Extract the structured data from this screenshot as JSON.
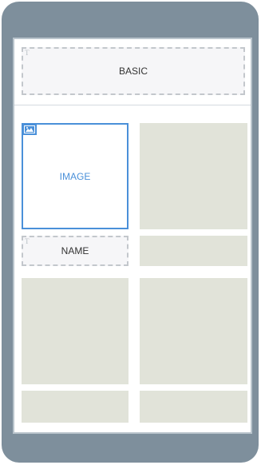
{
  "header": {
    "label": "BASIC"
  },
  "image_block": {
    "label": "IMAGE",
    "icon": "image-icon"
  },
  "name_block": {
    "label": "NAME"
  },
  "colors": {
    "frame": "#7e8f9c",
    "tile": "#e1e3d9",
    "selection": "#4a90d9"
  }
}
